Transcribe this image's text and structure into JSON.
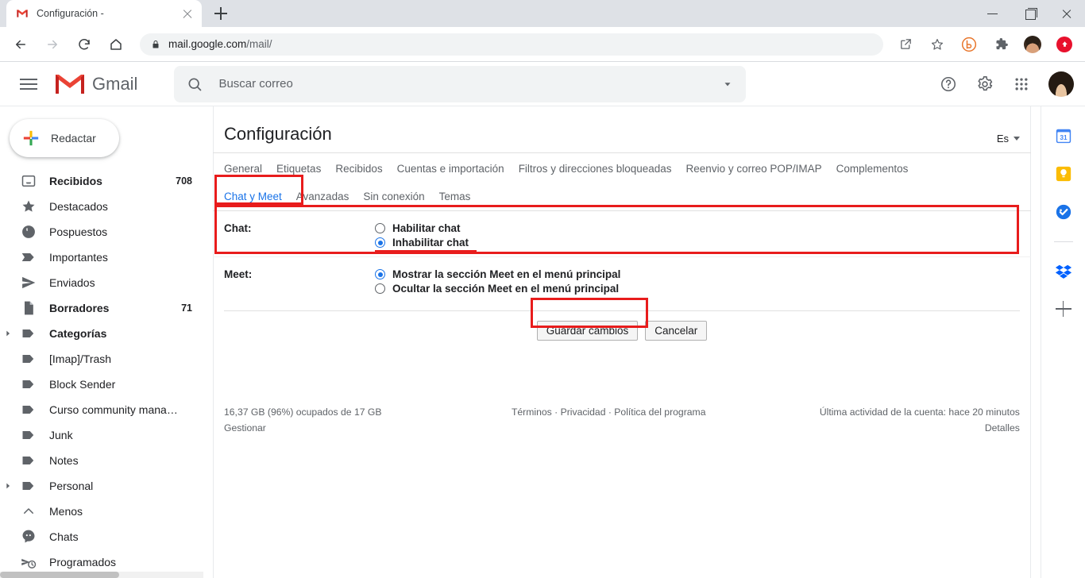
{
  "browser": {
    "tab": {
      "title": "Configuración -",
      "favicon": "gmail-m-icon"
    },
    "new_tab_label": "+",
    "url_secure": "mail.google.com",
    "url_path": "/mail/",
    "window_controls": {
      "minimize": "minimize-icon",
      "maximize": "maximize-icon",
      "close": "close-icon"
    },
    "toolbar_icons": [
      "back-icon",
      "forward-icon",
      "reload-icon",
      "home-icon",
      "lock-icon",
      "share-icon",
      "bookmark-star-icon",
      "honey-extension-icon",
      "extensions-puzzle-icon",
      "profile-avatar",
      "red-extension-icon"
    ]
  },
  "gmail": {
    "logo_text": "Gmail",
    "search": {
      "placeholder": "Buscar correo",
      "value": ""
    },
    "header_icons": [
      "help-icon",
      "settings-gear-icon",
      "google-apps-grid-icon",
      "account-avatar"
    ],
    "compose_label": "Redactar",
    "sidebar": {
      "items": [
        {
          "label": "Recibidos",
          "count": "708",
          "icon": "inbox-icon",
          "bold": true,
          "arrow": false
        },
        {
          "label": "Destacados",
          "count": "",
          "icon": "star-icon",
          "bold": false,
          "arrow": false
        },
        {
          "label": "Pospuestos",
          "count": "",
          "icon": "clock-icon",
          "bold": false,
          "arrow": false
        },
        {
          "label": "Importantes",
          "count": "",
          "icon": "label-important-icon",
          "bold": false,
          "arrow": false
        },
        {
          "label": "Enviados",
          "count": "",
          "icon": "send-icon",
          "bold": false,
          "arrow": false
        },
        {
          "label": "Borradores",
          "count": "71",
          "icon": "draft-icon",
          "bold": true,
          "arrow": false
        },
        {
          "label": "Categorías",
          "count": "",
          "icon": "label-icon",
          "bold": true,
          "arrow": true
        },
        {
          "label": "[Imap]/Trash",
          "count": "",
          "icon": "label-icon",
          "bold": false,
          "arrow": false
        },
        {
          "label": "Block Sender",
          "count": "",
          "icon": "label-icon",
          "bold": false,
          "arrow": false
        },
        {
          "label": "Curso community mana…",
          "count": "",
          "icon": "label-icon",
          "bold": false,
          "arrow": false
        },
        {
          "label": "Junk",
          "count": "",
          "icon": "label-icon",
          "bold": false,
          "arrow": false
        },
        {
          "label": "Notes",
          "count": "",
          "icon": "label-icon",
          "bold": false,
          "arrow": false
        },
        {
          "label": "Personal",
          "count": "",
          "icon": "label-icon",
          "bold": false,
          "arrow": true
        },
        {
          "label": "Menos",
          "count": "",
          "icon": "chevron-up-icon",
          "bold": false,
          "arrow": false
        },
        {
          "label": "Chats",
          "count": "",
          "icon": "chat-bubble-icon",
          "bold": false,
          "arrow": false
        },
        {
          "label": "Programados",
          "count": "",
          "icon": "scheduled-send-icon",
          "bold": false,
          "arrow": false
        }
      ]
    },
    "right_rail": [
      "google-calendar-icon",
      "google-keep-icon",
      "google-tasks-icon",
      "divider",
      "dropbox-icon",
      "add-addon-plus-icon"
    ]
  },
  "settings": {
    "title": "Configuración",
    "language_selector": "Es",
    "tabs_row1": [
      "General",
      "Etiquetas",
      "Recibidos",
      "Cuentas e importación",
      "Filtros y direcciones bloqueadas",
      "Reenvio y correo POP/IMAP",
      "Complementos"
    ],
    "tabs_row2": [
      {
        "label": "Chat y Meet",
        "active": true
      },
      {
        "label": "Avanzadas",
        "active": false
      },
      {
        "label": "Sin conexión",
        "active": false
      },
      {
        "label": "Temas",
        "active": false
      }
    ],
    "chat": {
      "label": "Chat:",
      "options": [
        {
          "label": "Habilitar chat",
          "checked": false,
          "highlighted": false
        },
        {
          "label": "Inhabilitar chat",
          "checked": true,
          "highlighted": true
        }
      ]
    },
    "meet": {
      "label": "Meet:",
      "options": [
        {
          "label": "Mostrar la sección Meet en el menú principal",
          "checked": true
        },
        {
          "label": "Ocultar la sección Meet en el menú principal",
          "checked": false
        }
      ]
    },
    "buttons": {
      "save": "Guardar cambios",
      "cancel": "Cancelar"
    }
  },
  "footer": {
    "storage": "16,37 GB (96%) ocupados de 17 GB",
    "manage": "Gestionar",
    "links": "Términos · Privacidad · Política del programa",
    "activity": "Última actividad de la cuenta: hace 20 minutos",
    "details": "Detalles"
  },
  "colors": {
    "accent_blue": "#1a73e8",
    "annotation_red": "#e81c1c",
    "gmail_red": "#ea4335"
  }
}
